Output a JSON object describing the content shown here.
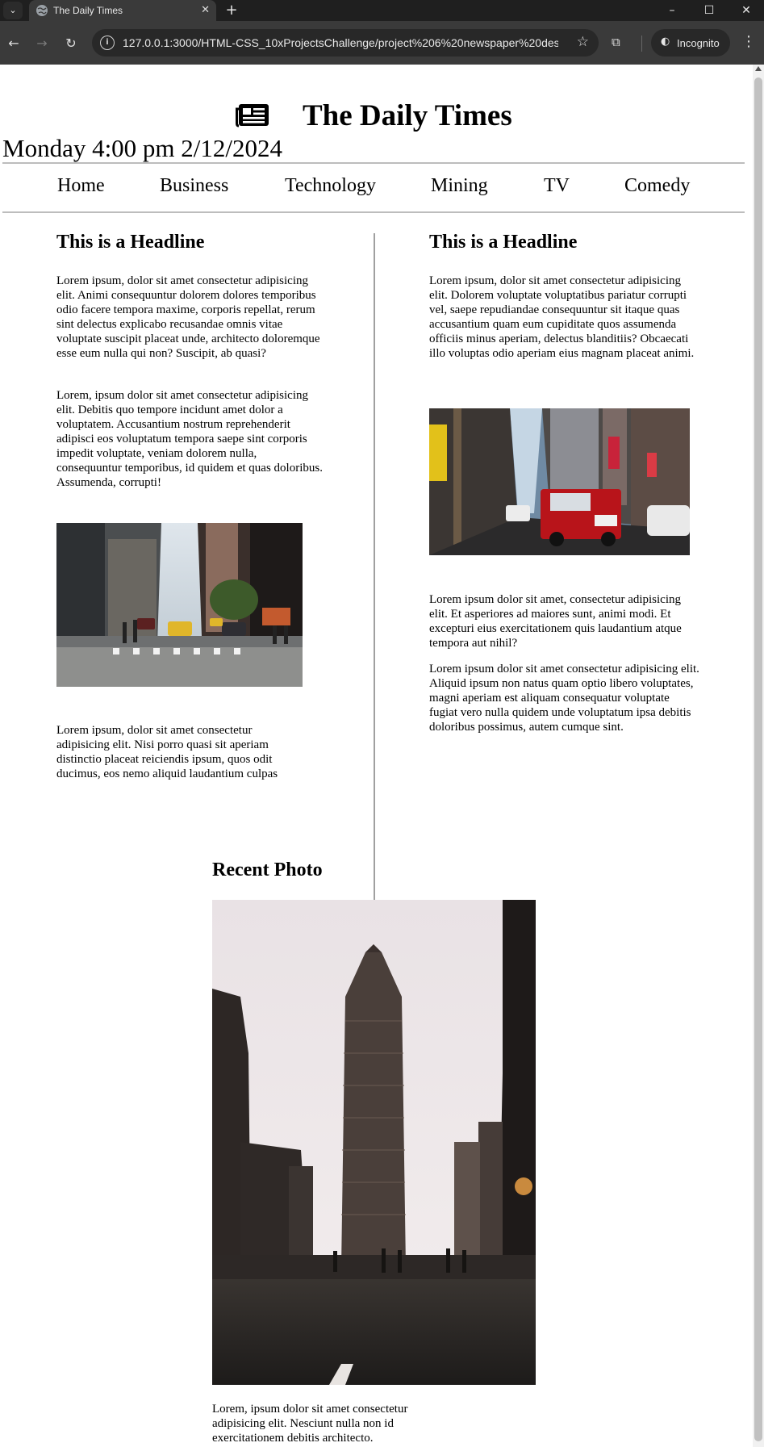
{
  "browser": {
    "tab_title": "The Daily Times",
    "url": "127.0.0.1:3000/HTML-CSS_10xProjectsChallenge/project%206%20newspaper%20desig...",
    "incognito_label": "Incognito"
  },
  "page": {
    "site_title": "The Daily Times",
    "dateline": "Monday 4:00 pm 2/12/2024",
    "nav": [
      "Home",
      "Business",
      "Technology",
      "Mining",
      "TV",
      "Comedy"
    ],
    "left_column": {
      "headline": "This is a Headline",
      "paragraph1": "Lorem ipsum, dolor sit amet consectetur adipisicing elit. Animi consequuntur dolorem dolores temporibus odio facere tempora maxime, corporis repellat, rerum sint delectus explicabo recusandae omnis vitae voluptate suscipit placeat unde, architecto doloremque esse eum nulla qui non? Suscipit, ab quasi?",
      "paragraph2": "Lorem, ipsum dolor sit amet consectetur adipisicing elit. Debitis quo tempore incidunt amet dolor a voluptatem. Accusantium nostrum reprehenderit adipisci eos voluptatum tempora saepe sint corporis impedit voluptate, veniam dolorem nulla, consequuntur temporibus, id quidem et quas doloribus. Assumenda, corrupti!",
      "paragraph3": "Lorem ipsum, dolor sit amet consectetur adipisicing elit. Nisi porro quasi sit aperiam distinctio placeat reiciendis ipsum, quos odit ducimus, eos nemo aliquid laudantium culpas"
    },
    "right_column": {
      "headline": "This is a Headline",
      "paragraph1": "Lorem ipsum, dolor sit amet consectetur adipisicing elit. Dolorem voluptate voluptatibus pariatur corrupti vel, saepe repudiandae consequuntur sit itaque quas accusantium quam eum cupiditate quos assumenda officiis minus aperiam, delectus blanditiis? Obcaecati illo voluptas odio aperiam eius magnam placeat animi.",
      "paragraph2": "Lorem ipsum dolor sit amet, consectetur adipisicing elit. Et asperiores ad maiores sunt, animi modi. Et excepturi eius exercitationem quis laudantium atque tempora aut nihil?",
      "paragraph3": "Lorem ipsum dolor sit amet consectetur adipisicing elit. Aliquid ipsum non natus quam optio libero voluptates, magni aperiam est aliquam consequatur voluptate fugiat vero nulla quidem unde voluptatum ipsa debitis doloribus possimus, autem cumque sint."
    },
    "recent": {
      "title": "Recent Photo",
      "caption": "Lorem, ipsum dolor sit amet consectetur adipisicing elit. Nesciunt nulla non id exercitationem debitis architecto."
    }
  },
  "icons": {
    "tab": "globe-icon",
    "masthead": "newspaper-icon"
  },
  "colors": {
    "chrome_dark": "#1f1f1f",
    "chrome_toolbar": "#3a3a3a",
    "rule": "#bdbdbd"
  }
}
